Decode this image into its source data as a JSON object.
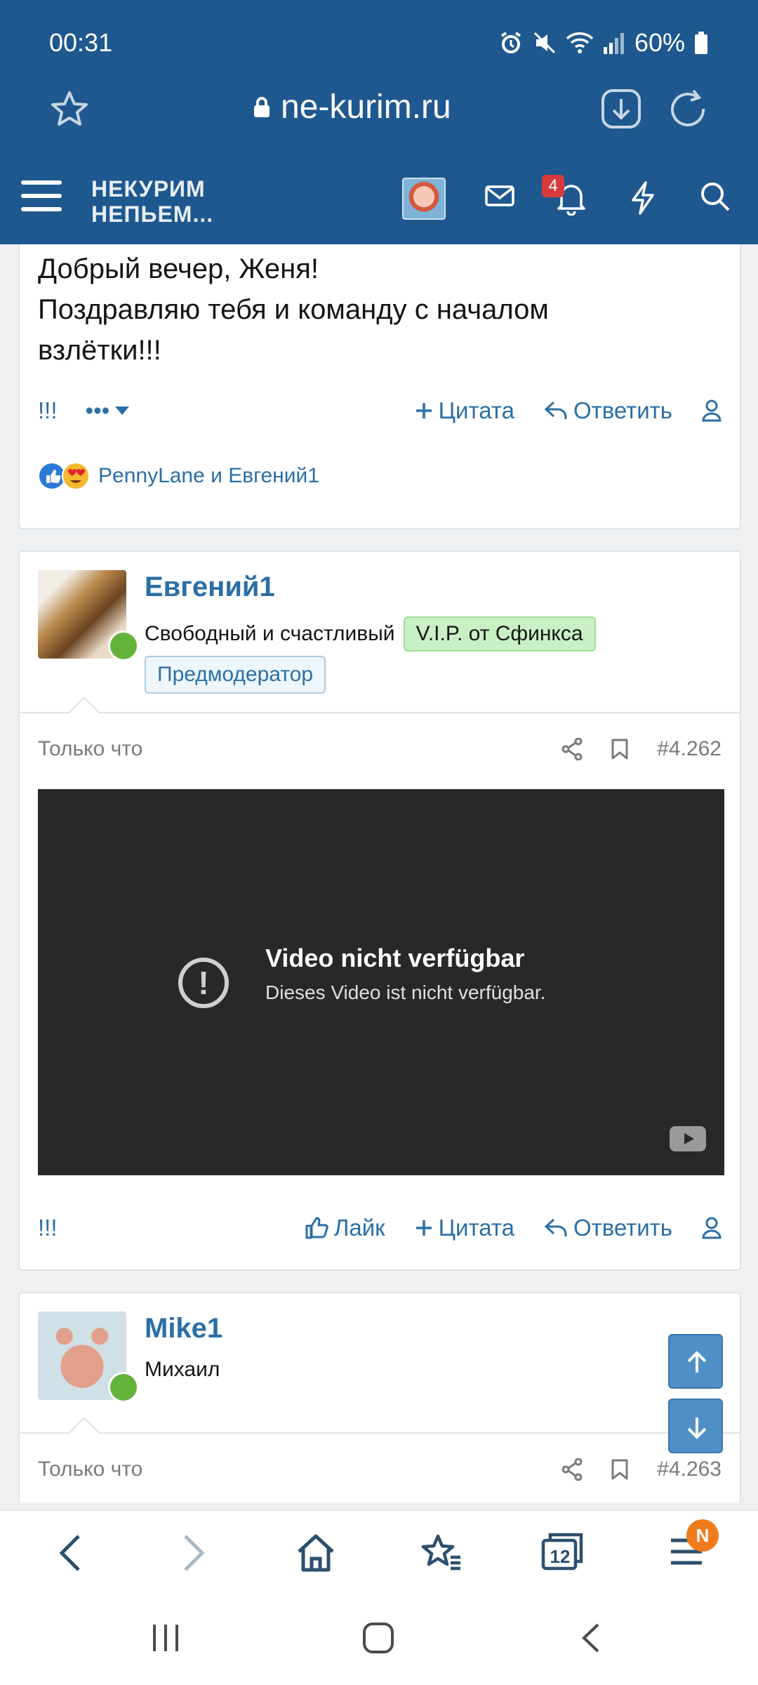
{
  "status": {
    "time": "00:31",
    "battery": "60%"
  },
  "browser": {
    "url": "ne-kurim.ru"
  },
  "site": {
    "logo_line1": "НЕКУРИМ",
    "logo_line2": "НЕПЬЕМ...",
    "notif_count": "4"
  },
  "post1": {
    "text_line1": "Добрый вечер, Женя!",
    "text_line2": "Поздравляю тебя и команду с началом",
    "text_line3": "взлётки!!!",
    "excl": "!!!",
    "more": "•••",
    "quote": "Цитата",
    "reply": "Ответить",
    "reactions_text": "PennyLane и Евгений1"
  },
  "post2": {
    "username": "Евгений1",
    "user_title": "Свободный и счастливый",
    "vip_badge": "V.I.P. от Сфинкса",
    "role": "Предмодератор",
    "time": "Только что",
    "post_number": "#4.262",
    "video_title": "Video nicht verfügbar",
    "video_subtitle": "Dieses Video ist nicht verfügbar.",
    "excl": "!!!",
    "like": "Лайк",
    "quote": "Цитата",
    "reply": "Ответить"
  },
  "post3": {
    "username": "Mike1",
    "user_title": "Михаил",
    "time": "Только что",
    "post_number": "#4.263"
  },
  "toolbar": {
    "tabs_count": "12",
    "menu_badge": "N"
  },
  "colors": {
    "header": "#1e588f",
    "link": "#2a6fa6",
    "vip_bg": "#c9f0c5",
    "online": "#63b33b"
  }
}
